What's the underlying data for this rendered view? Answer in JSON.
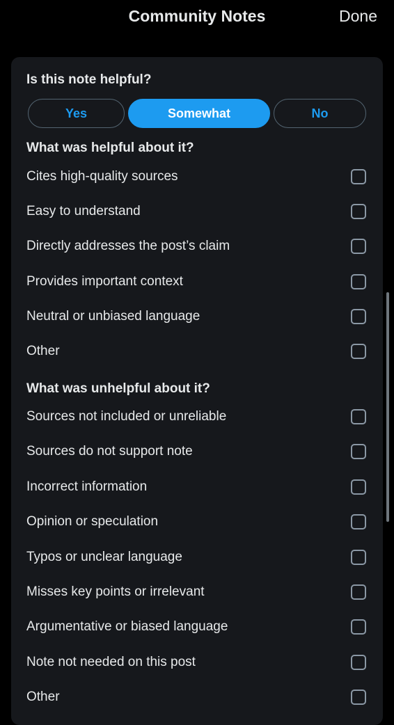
{
  "header": {
    "title": "Community Notes",
    "done_label": "Done"
  },
  "rating": {
    "question": "Is this note helpful?",
    "options": [
      "Yes",
      "Somewhat",
      "No"
    ],
    "selected": "Somewhat"
  },
  "helpful": {
    "heading": "What was helpful about it?",
    "items": [
      "Cites high-quality sources",
      "Easy to understand",
      "Directly addresses the post’s claim",
      "Provides important context",
      "Neutral or unbiased language",
      "Other"
    ]
  },
  "unhelpful": {
    "heading": "What was unhelpful about it?",
    "items": [
      "Sources not included or unreliable",
      "Sources do not support note",
      "Incorrect information",
      "Opinion or speculation",
      "Typos or unclear language",
      "Misses key points or irrelevant",
      "Argumentative or biased language",
      "Note not needed on this post",
      "Other"
    ]
  },
  "colors": {
    "accent": "#1d9bf0",
    "panel": "#16181c",
    "background": "#000000"
  }
}
